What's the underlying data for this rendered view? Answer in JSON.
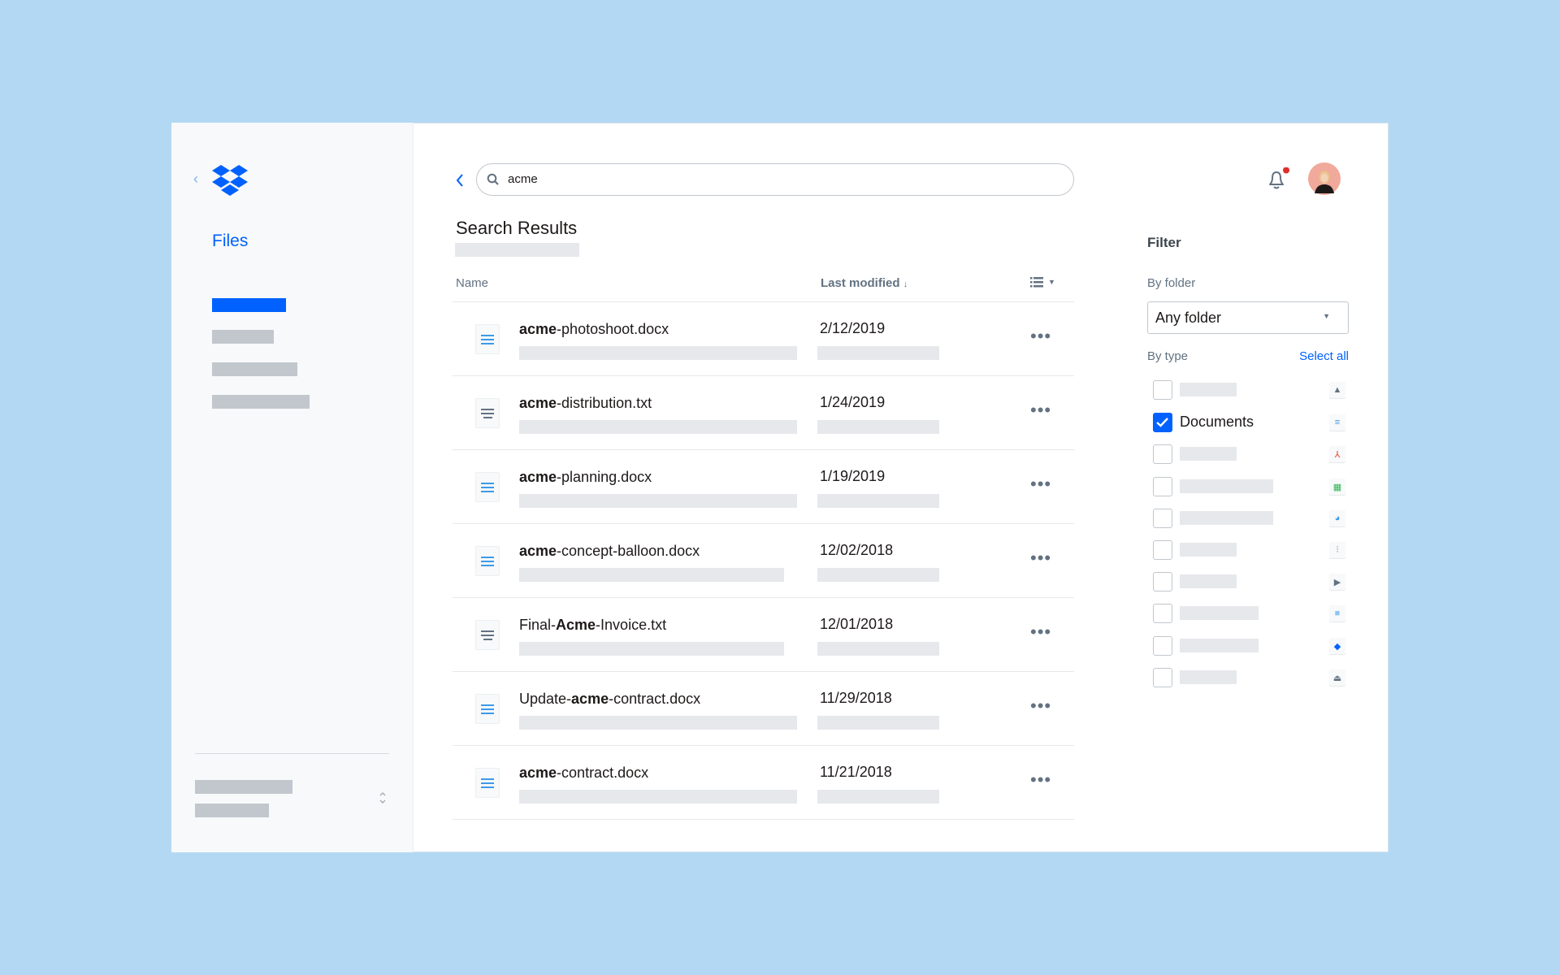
{
  "sidebar": {
    "nav_title": "Files"
  },
  "search": {
    "value": "acme",
    "placeholder": ""
  },
  "main": {
    "title": "Search Results",
    "columns": {
      "name": "Name",
      "modified": "Last modified",
      "sort_indicator": "↓"
    },
    "rows": [
      {
        "pre": "",
        "bold": "acme",
        "post": "-photoshoot.docx",
        "date": "2/12/2019",
        "type": "docx"
      },
      {
        "pre": "",
        "bold": "acme",
        "post": "-distribution.txt",
        "date": "1/24/2019",
        "type": "txt"
      },
      {
        "pre": "",
        "bold": "acme",
        "post": "-planning.docx",
        "date": "1/19/2019",
        "type": "docx"
      },
      {
        "pre": "",
        "bold": "acme",
        "post": "-concept-balloon.docx",
        "date": "12/02/2018",
        "type": "docx"
      },
      {
        "pre": "Final-",
        "bold": "Acme",
        "post": "-Invoice.txt",
        "date": "12/01/2018",
        "type": "txt"
      },
      {
        "pre": "Update-",
        "bold": "acme",
        "post": "-contract.docx",
        "date": "11/29/2018",
        "type": "docx"
      },
      {
        "pre": "",
        "bold": "acme",
        "post": "-contract.docx",
        "date": "11/21/2018",
        "type": "docx"
      }
    ]
  },
  "filter": {
    "title": "Filter",
    "by_folder": "By folder",
    "folder_value": "Any folder",
    "by_type": "By type",
    "select_all": "Select all",
    "types": [
      {
        "label": "",
        "checked": false,
        "icon": "image-icon"
      },
      {
        "label": "Documents",
        "checked": true,
        "icon": "document-icon"
      },
      {
        "label": "",
        "checked": false,
        "icon": "pdf-icon"
      },
      {
        "label": "",
        "checked": false,
        "icon": "spreadsheet-icon"
      },
      {
        "label": "",
        "checked": false,
        "icon": "presentation-icon"
      },
      {
        "label": "",
        "checked": false,
        "icon": "audio-icon"
      },
      {
        "label": "",
        "checked": false,
        "icon": "video-icon"
      },
      {
        "label": "",
        "checked": false,
        "icon": "folder-icon"
      },
      {
        "label": "",
        "checked": false,
        "icon": "dropbox-file-icon"
      },
      {
        "label": "",
        "checked": false,
        "icon": "other-file-icon"
      }
    ]
  },
  "colors": {
    "accent": "#0061fe",
    "notification": "#e02d2d",
    "background": "#b3d8f3"
  }
}
